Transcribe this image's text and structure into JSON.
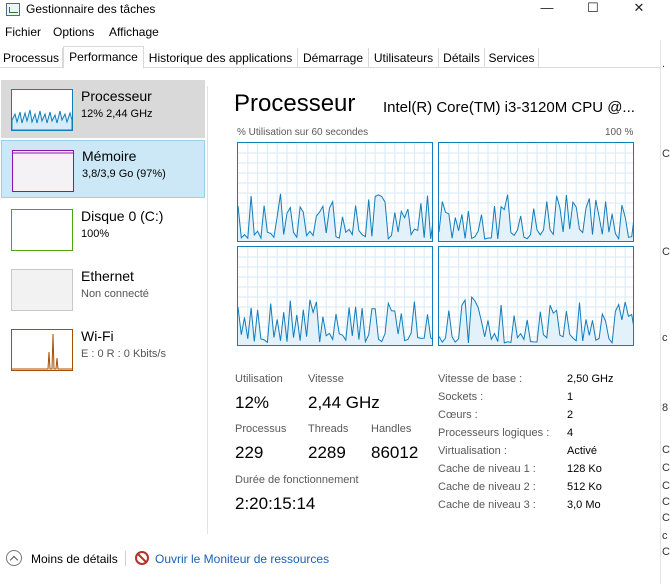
{
  "window": {
    "title": "Gestionnaire des tâches",
    "controls": {
      "minimize": "—",
      "maximize": "☐",
      "close": "✕"
    }
  },
  "menu": [
    "Fichier",
    "Options",
    "Affichage"
  ],
  "tabs": [
    "Processus",
    "Performance",
    "Historique des applications",
    "Démarrage",
    "Utilisateurs",
    "Détails",
    "Services"
  ],
  "active_tab": "Performance",
  "sidebar": {
    "items": [
      {
        "name": "Processeur",
        "sub": "12%  2,44 GHz",
        "color": "#117dbb",
        "selected": true
      },
      {
        "name": "Mémoire",
        "sub": "3,8/3,9 Go (97%)",
        "color": "#8b12ae",
        "selected": false
      },
      {
        "name": "Disque 0 (C:)",
        "sub": "100%",
        "color": "#4da60c",
        "selected": false
      },
      {
        "name": "Ethernet",
        "sub": "Non connecté",
        "color": "#a0a0a0",
        "selected": false
      },
      {
        "name": "Wi-Fi",
        "sub": "E : 0  R : 0 Kbits/s",
        "color": "#a74f01",
        "selected": false
      }
    ]
  },
  "main": {
    "title": "Processeur",
    "model": "Intel(R) Core(TM) i3-3120M CPU @...",
    "graph_caption_left": "% Utilisation sur 60 secondes",
    "graph_caption_right": "100 %",
    "stats": {
      "utilisation_label": "Utilisation",
      "utilisation_value": "12%",
      "vitesse_label": "Vitesse",
      "vitesse_value": "2,44 GHz",
      "processus_label": "Processus",
      "processus_value": "229",
      "threads_label": "Threads",
      "threads_value": "2289",
      "handles_label": "Handles",
      "handles_value": "86012",
      "uptime_label": "Durée de fonctionnement",
      "uptime_value": "2:20:15:14"
    },
    "specs": [
      {
        "label": "Vitesse de base :",
        "value": "2,50 GHz"
      },
      {
        "label": "Sockets :",
        "value": "1"
      },
      {
        "label": "Cœurs :",
        "value": "2"
      },
      {
        "label": "Processeurs logiques :",
        "value": "4"
      },
      {
        "label": "Virtualisation :",
        "value": "Activé"
      },
      {
        "label": "Cache de niveau 1 :",
        "value": "128 Ko"
      },
      {
        "label": "Cache de niveau 2 :",
        "value": "512 Ko"
      },
      {
        "label": "Cache de niveau 3 :",
        "value": "3,0 Mo"
      }
    ]
  },
  "footer": {
    "less_details": "Moins de détails",
    "resource_monitor": "Ouvrir le Moniteur de ressources"
  },
  "right_strip_letters": [
    ".",
    "C",
    "C",
    "c",
    "8",
    "C",
    "C",
    "C",
    "C",
    "C",
    "c",
    "C"
  ],
  "colors": {
    "cpu_graph": "#117dbb",
    "selection": "#cce8f6",
    "link": "#1a5fb4"
  }
}
